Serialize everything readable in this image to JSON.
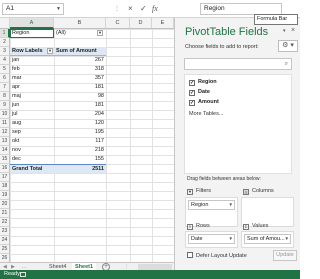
{
  "formula_bar": {
    "name_box": "A1",
    "cancel_icon": "×",
    "enter_icon": "✓",
    "fx_label": "fx",
    "content": "Region",
    "tooltip": "Formula Bar"
  },
  "sheet": {
    "columns": [
      "A",
      "B",
      "C",
      "D",
      "E"
    ],
    "rows": [
      "1",
      "2",
      "3",
      "4",
      "5",
      "6",
      "7",
      "8",
      "9",
      "10",
      "11",
      "12",
      "13",
      "14",
      "15",
      "16",
      "17",
      "18",
      "19",
      "20",
      "21",
      "22",
      "23",
      "24",
      "25",
      "26"
    ],
    "filter": {
      "label": "Region",
      "value": "(All)"
    },
    "pivot_headers": {
      "row_labels": "Row Labels",
      "sum": "Sum of Amount"
    },
    "pivot_rows": [
      {
        "label": "jan",
        "value": "267"
      },
      {
        "label": "feb",
        "value": "318"
      },
      {
        "label": "mar",
        "value": "357"
      },
      {
        "label": "apr",
        "value": "181"
      },
      {
        "label": "maj",
        "value": "98"
      },
      {
        "label": "jun",
        "value": "181"
      },
      {
        "label": "jul",
        "value": "204"
      },
      {
        "label": "aug",
        "value": "120"
      },
      {
        "label": "sep",
        "value": "195"
      },
      {
        "label": "okt",
        "value": "117"
      },
      {
        "label": "nov",
        "value": "218"
      },
      {
        "label": "dec",
        "value": "155"
      }
    ],
    "grand_total": {
      "label": "Grand Total",
      "value": "2511"
    }
  },
  "tabs": {
    "prev": "◀",
    "next": "▶",
    "ellipsis": "...",
    "sheets": [
      "Sheet4",
      "Sheet1"
    ],
    "active": "Sheet1",
    "add": "+"
  },
  "status": {
    "text": "Ready"
  },
  "pivot_pane": {
    "title": "PivotTable Fields",
    "title_dropdown": "▾",
    "close": "×",
    "choose_label": "Choose fields to add to report:",
    "gear": "⚙ ▾",
    "search_icon": "⌕",
    "fields": [
      {
        "name": "Region",
        "checked": "✓"
      },
      {
        "name": "Date",
        "checked": "✓"
      },
      {
        "name": "Amount",
        "checked": "✓"
      }
    ],
    "more_tables": "More Tables...",
    "drag_text": "Drag fields between areas below:",
    "areas": {
      "filters": {
        "label": "Filters",
        "icon": "▼",
        "items": [
          "Region"
        ]
      },
      "columns": {
        "label": "Columns",
        "icon": "|||",
        "items": []
      },
      "rows": {
        "label": "Rows",
        "icon": "≡",
        "items": [
          "Date"
        ]
      },
      "values": {
        "label": "Values",
        "icon": "Σ",
        "items": [
          "Sum of Amou..."
        ]
      }
    },
    "defer_label": "Defer Layout Update",
    "update_button": "Update"
  },
  "colors": {
    "accent": "#217346",
    "pivot_header": "#dde8f4",
    "pivot_border": "#5b87c3"
  }
}
